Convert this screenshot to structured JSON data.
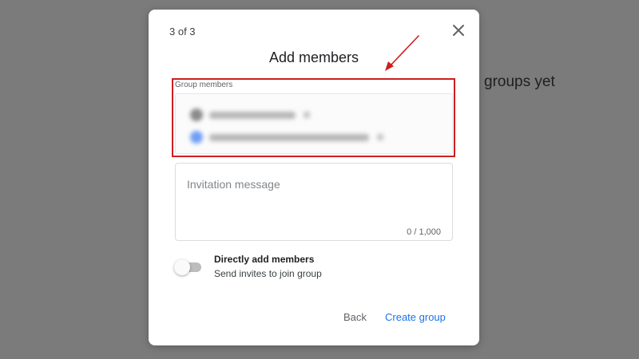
{
  "background": {
    "partial_text": "groups yet"
  },
  "dialog": {
    "step": "3 of 3",
    "title": "Add members",
    "group_members_label": "Group members",
    "invitation_placeholder": "Invitation message",
    "char_count": "0 / 1,000",
    "toggle": {
      "on": false,
      "title": "Directly add members",
      "subtitle": "Send invites to join group"
    },
    "buttons": {
      "back": "Back",
      "create": "Create group"
    }
  },
  "icons": [
    "close-icon",
    "annotation-arrow"
  ],
  "colors": {
    "accent": "#1a73e8",
    "highlight": "#cc1f1f",
    "overlay": "#7b7b7b"
  }
}
